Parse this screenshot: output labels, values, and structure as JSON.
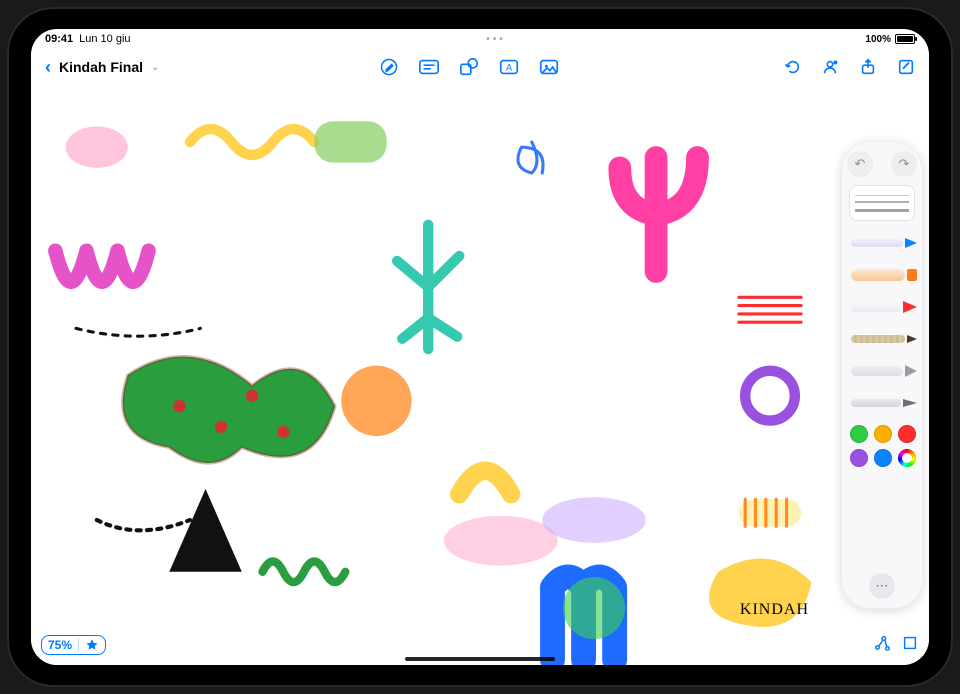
{
  "status": {
    "time": "09:41",
    "date": "Lun 10 giu",
    "battery_pct": "100%"
  },
  "nav": {
    "document_title": "Kindah Final"
  },
  "toolbar_center": {
    "pencil_mode": "pencil-mode-icon",
    "text_box": "textbox-icon",
    "shapes": "shapes-icon",
    "text_style": "textstyle-icon",
    "media": "media-icon"
  },
  "toolbar_right": {
    "undo": "undo-icon",
    "collab": "collab-icon",
    "share": "share-icon",
    "new": "new-icon"
  },
  "palette": {
    "undo": "undo",
    "redo": "redo",
    "tools": [
      "pen",
      "watercolor",
      "marker",
      "pencil",
      "crayon",
      "fountain"
    ],
    "swatches": [
      "#2ecc40",
      "#ffae00",
      "#ff2d2d",
      "#9b51e0",
      "#0a84ff",
      "wheel"
    ]
  },
  "zoom": {
    "value": "75%"
  },
  "canvas": {
    "signature": "KINDAH"
  },
  "bottom_right": {
    "shapes": "vector-shapes-icon",
    "crop": "crop-icon"
  }
}
